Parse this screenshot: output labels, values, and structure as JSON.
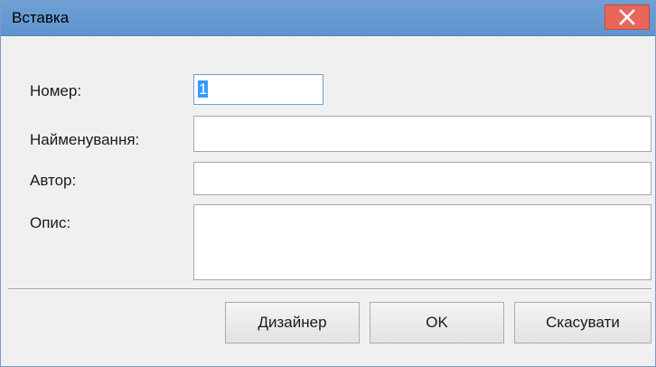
{
  "window": {
    "title": "Вставка",
    "close_icon": "close-icon"
  },
  "form": {
    "number_label": "Номер:",
    "number_value": "1",
    "name_label": "Найменування:",
    "name_value": "",
    "author_label": "Автор:",
    "author_value": "",
    "description_label": "Опис:",
    "description_value": ""
  },
  "buttons": {
    "designer_label": "Дизайнер",
    "ok_label": "OK",
    "cancel_label": "Скасувати"
  },
  "colors": {
    "titlebar": "#6ea0d6",
    "close_button": "#e8665a",
    "selection": "#3399ff"
  }
}
